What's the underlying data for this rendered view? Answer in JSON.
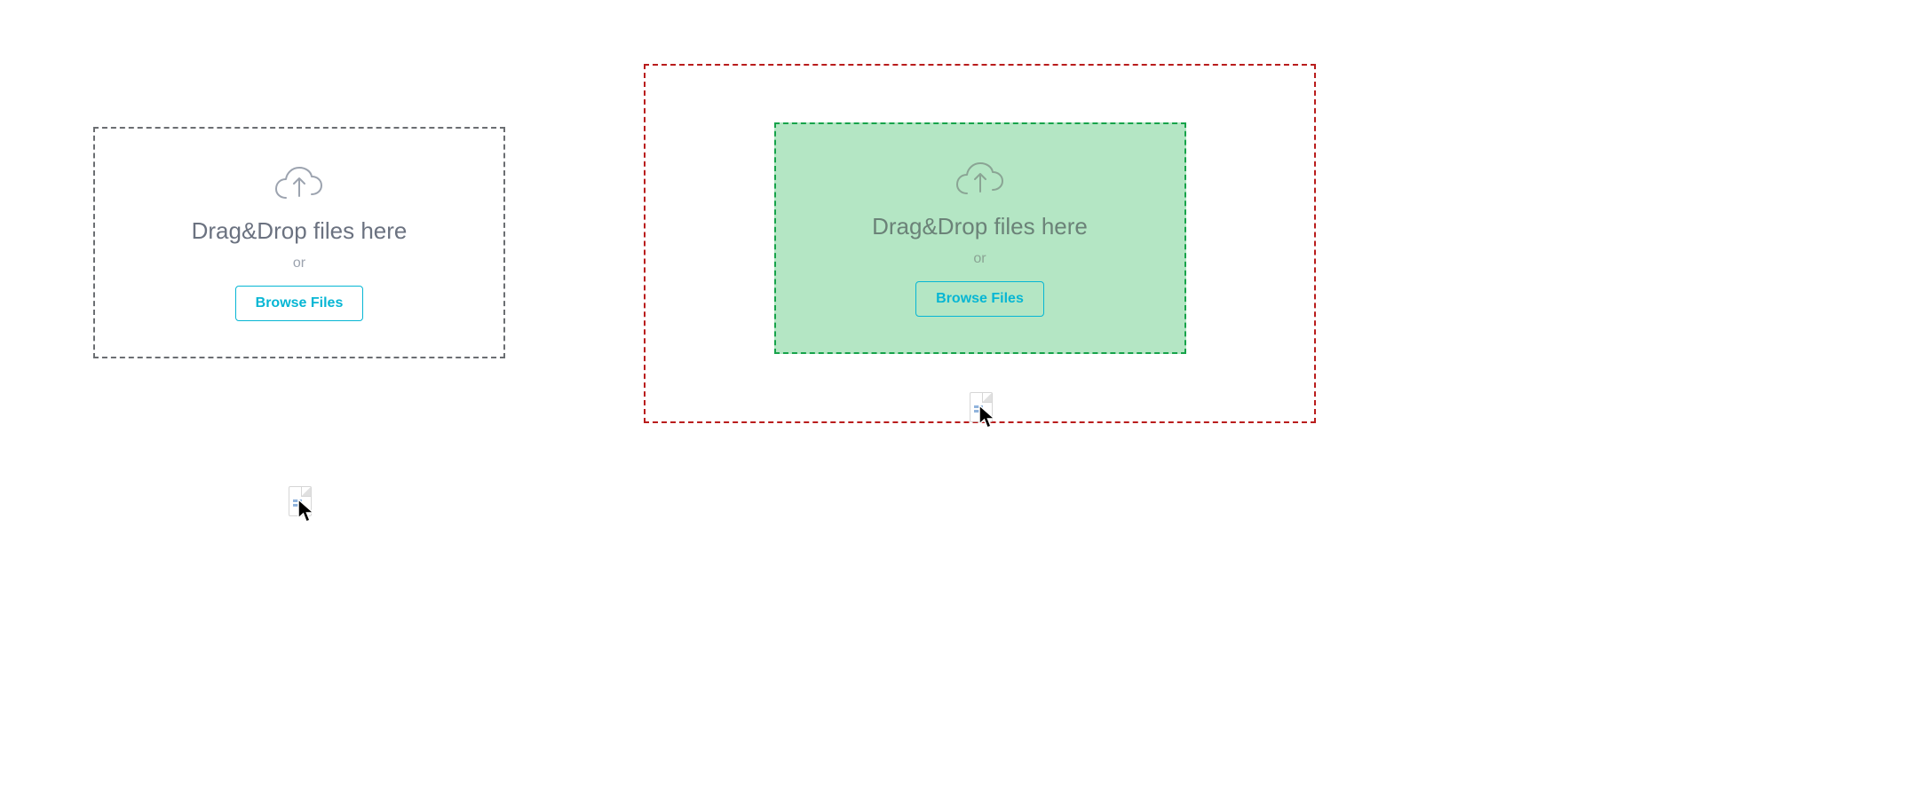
{
  "dropzones": {
    "left": {
      "title": "Drag&Drop files here",
      "or": "or",
      "browse": "Browse Files"
    },
    "right": {
      "title": "Drag&Drop files here",
      "or": "or",
      "browse": "Browse Files"
    }
  },
  "colors": {
    "inactive_border": "#6b6e72",
    "active_inner_border": "#16a34a",
    "active_inner_bg": "#b4e6c4",
    "padding_zone_border": "#b91c1c",
    "accent": "#06b6d4"
  }
}
